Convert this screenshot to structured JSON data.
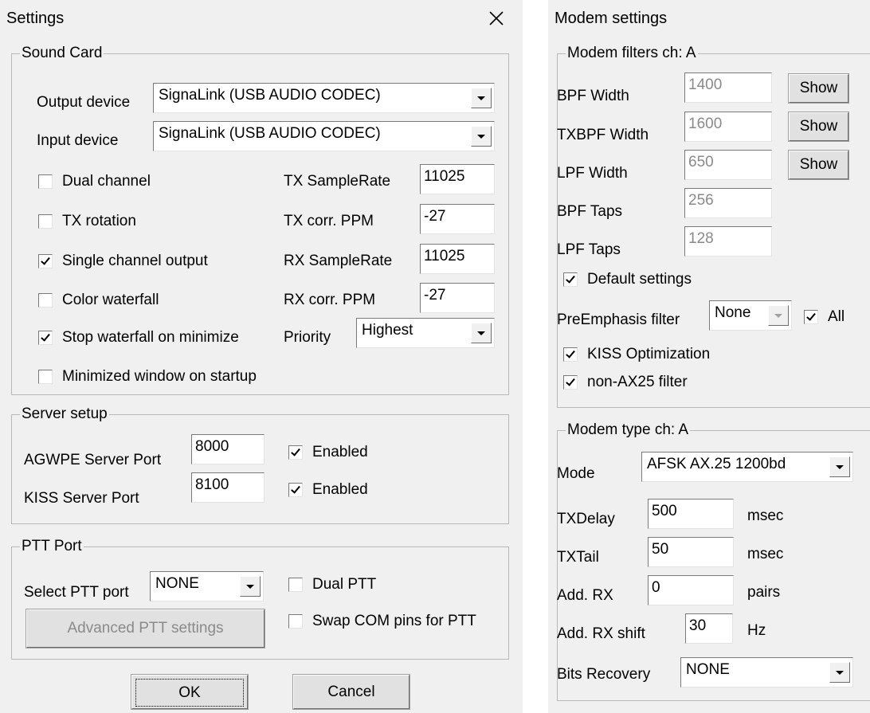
{
  "settings": {
    "title": "Settings",
    "sound_card": {
      "legend": "Sound Card",
      "output_device_label": "Output device",
      "output_device_value": "SignaLink (USB AUDIO  CODEC)",
      "input_device_label": "Input device",
      "input_device_value": "SignaLink (USB AUDIO  CODEC)",
      "dual_channel": "Dual channel",
      "tx_rotation": "TX rotation",
      "single_channel_output": "Single channel output",
      "color_waterfall": "Color waterfall",
      "stop_waterfall": "Stop waterfall on minimize",
      "minimized_window": "Minimized window on startup",
      "tx_samplerate_label": "TX SampleRate",
      "tx_samplerate_value": "11025",
      "tx_corr_label": "TX corr. PPM",
      "tx_corr_value": "-27",
      "rx_samplerate_label": "RX SampleRate",
      "rx_samplerate_value": "11025",
      "rx_corr_label": "RX corr. PPM",
      "rx_corr_value": "-27",
      "priority_label": "Priority",
      "priority_value": "Highest"
    },
    "server_setup": {
      "legend": "Server setup",
      "agwpe_label": "AGWPE Server Port",
      "agwpe_value": "8000",
      "agwpe_enabled": "Enabled",
      "kiss_label": "KISS Server Port",
      "kiss_value": "8100",
      "kiss_enabled": "Enabled"
    },
    "ptt_port": {
      "legend": "PTT Port",
      "select_label": "Select PTT port",
      "select_value": "NONE",
      "dual_ptt": "Dual PTT",
      "swap_com": "Swap COM pins for PTT",
      "advanced_button": "Advanced PTT settings"
    },
    "ok_button": "OK",
    "cancel_button": "Cancel"
  },
  "modem": {
    "title": "Modem settings",
    "filters": {
      "legend": "Modem filters ch: A",
      "bpf_width_label": "BPF Width",
      "bpf_width_value": "1400",
      "txbpf_width_label": "TXBPF Width",
      "txbpf_width_value": "1600",
      "lpf_width_label": "LPF Width",
      "lpf_width_value": "650",
      "bpf_taps_label": "BPF Taps",
      "bpf_taps_value": "256",
      "lpf_taps_label": "LPF Taps",
      "lpf_taps_value": "128",
      "show_button": "Show",
      "default_settings": "Default settings",
      "preemphasis_label": "PreEmphasis filter",
      "preemphasis_value": "None",
      "all_label": "All",
      "kiss_optimization": "KISS Optimization",
      "non_ax25": "non-AX25 filter"
    },
    "type": {
      "legend": "Modem type ch: A",
      "mode_label": "Mode",
      "mode_value": "AFSK AX.25 1200bd",
      "txdelay_label": "TXDelay",
      "txdelay_value": "500",
      "txdelay_unit": "msec",
      "txtail_label": "TXTail",
      "txtail_value": "50",
      "txtail_unit": "msec",
      "addrx_label": "Add. RX",
      "addrx_value": "0",
      "addrx_unit": "pairs",
      "addrx_shift_label": "Add. RX shift",
      "addrx_shift_value": "30",
      "addrx_shift_unit": "Hz",
      "bits_label": "Bits Recovery",
      "bits_value": "NONE"
    }
  }
}
